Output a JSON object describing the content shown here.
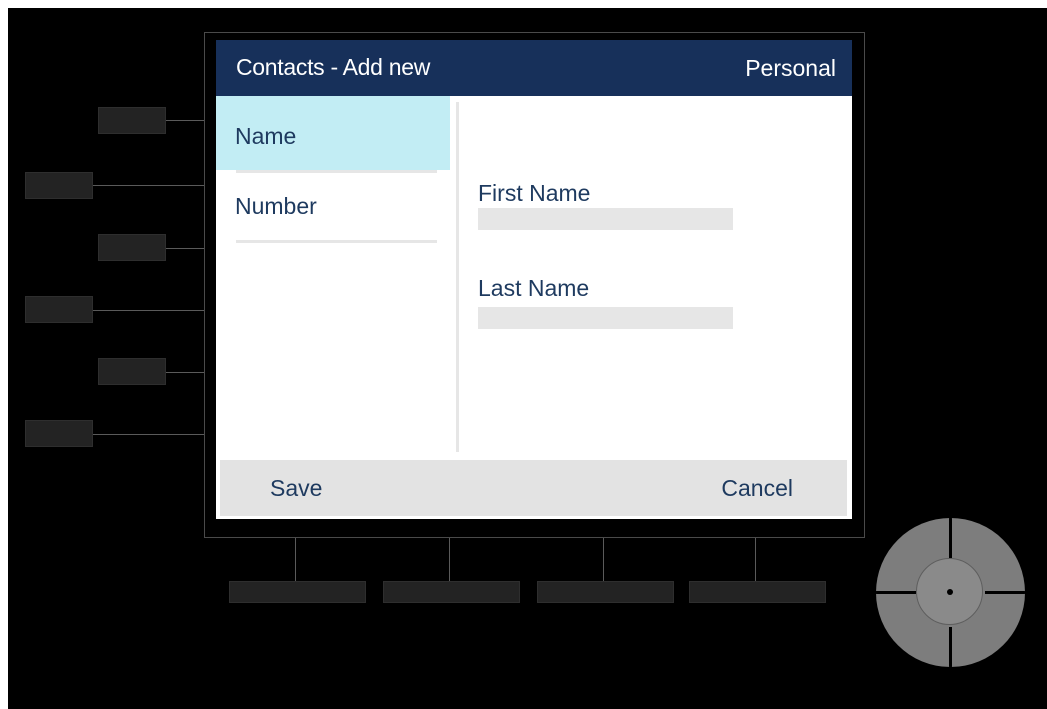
{
  "window": {
    "title": "Contacts - Add new",
    "profile": "Personal"
  },
  "menu": {
    "items": [
      {
        "label": "Name",
        "selected": true
      },
      {
        "label": "Number",
        "selected": false
      }
    ]
  },
  "form": {
    "first_name": {
      "label": "First Name",
      "value": ""
    },
    "last_name": {
      "label": "Last Name",
      "value": ""
    }
  },
  "softkeys": {
    "save_label": "Save",
    "cancel_label": "Cancel"
  },
  "colors": {
    "title_bar": "#17305a",
    "selected_item": "#c2edf4",
    "text": "#1e3a5f",
    "softkey_bar": "#e3e3e3"
  },
  "icons": {
    "navigation_pad": "navigation-pad-icon"
  }
}
